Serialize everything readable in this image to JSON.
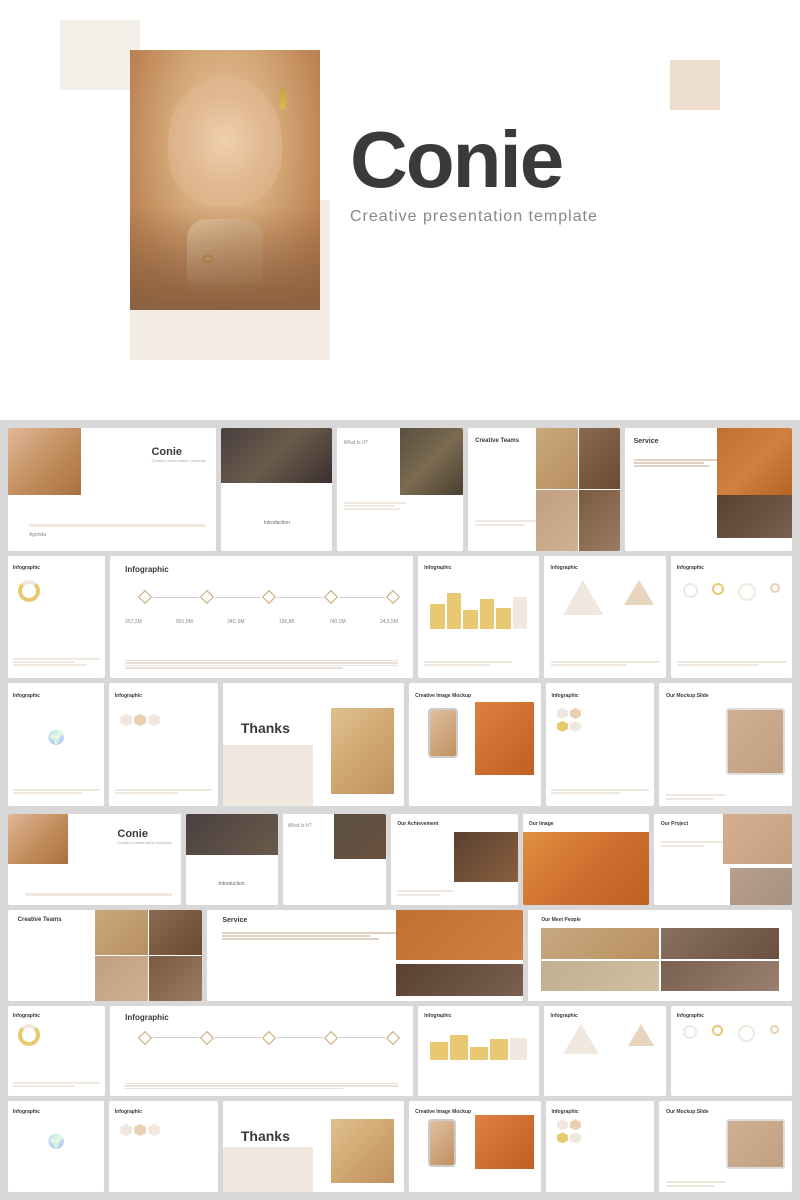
{
  "hero": {
    "title": "Conie",
    "subtitle": "Creative presentation template",
    "bg_color": "#ffffff",
    "accent_color": "#f0e8df",
    "text_color": "#3a3a3a"
  },
  "slides": {
    "row1": [
      {
        "id": "conie-main",
        "type": "title",
        "title": "Conie",
        "subtitle": "Creative presentation template"
      },
      {
        "id": "intro",
        "type": "section",
        "label": "Introduction"
      },
      {
        "id": "what-is-it",
        "type": "content",
        "label": "What Is It?"
      },
      {
        "id": "creative-teams",
        "type": "content",
        "label": "Creative Teams"
      },
      {
        "id": "service",
        "type": "content",
        "label": "Service"
      }
    ],
    "row2": [
      {
        "id": "infographic-1",
        "type": "infographic",
        "label": "Infographic"
      },
      {
        "id": "infographic-main",
        "type": "infographic",
        "label": "Infographic"
      },
      {
        "id": "infographic-3",
        "type": "infographic",
        "label": "Infographic"
      },
      {
        "id": "infographic-4",
        "type": "infographic",
        "label": "Infographic"
      },
      {
        "id": "infographic-5",
        "type": "infographic",
        "label": "Infographic"
      }
    ],
    "row3": [
      {
        "id": "infographic-6",
        "type": "infographic",
        "label": "Infographic"
      },
      {
        "id": "infographic-7",
        "type": "infographic",
        "label": "Infographic"
      },
      {
        "id": "thanks-1",
        "type": "thanks",
        "label": "Thanks"
      },
      {
        "id": "creative-image",
        "type": "content",
        "label": "Creative Image Mockup"
      },
      {
        "id": "infographic-8",
        "type": "infographic",
        "label": "Infographic"
      },
      {
        "id": "our-mockup",
        "type": "content",
        "label": "Our Mockup Slide"
      }
    ],
    "row4": [
      {
        "id": "conie-2",
        "type": "title",
        "title": "Conie",
        "subtitle": "Creative presentation template"
      },
      {
        "id": "intro-2",
        "type": "section",
        "label": "Introduction"
      },
      {
        "id": "what-2",
        "type": "content",
        "label": "What Is It?"
      },
      {
        "id": "achievement",
        "type": "content",
        "label": "Our Achievement"
      },
      {
        "id": "our-image",
        "type": "content",
        "label": "Our Image"
      },
      {
        "id": "our-project",
        "type": "content",
        "label": "Our Project"
      }
    ],
    "row5": [
      {
        "id": "creative-2",
        "type": "content",
        "label": "Creative Teams"
      },
      {
        "id": "service-2",
        "type": "content",
        "label": "Service"
      },
      {
        "id": "meet-people",
        "type": "content",
        "label": "Our Meet People"
      }
    ],
    "row6": [
      {
        "id": "infographic-9",
        "type": "infographic",
        "label": "Infographic"
      },
      {
        "id": "infographic-10",
        "type": "infographic",
        "label": "Infographic"
      },
      {
        "id": "infographic-11",
        "type": "infographic",
        "label": "Infographic"
      },
      {
        "id": "infographic-12",
        "type": "infographic",
        "label": "Infographic"
      },
      {
        "id": "infographic-13",
        "type": "infographic",
        "label": "Infographic"
      }
    ],
    "row7": [
      {
        "id": "infographic-14",
        "type": "infographic",
        "label": "Infographic"
      },
      {
        "id": "infographic-15",
        "type": "infographic",
        "label": "Infographic"
      },
      {
        "id": "thanks-2",
        "type": "thanks",
        "label": "Thanks"
      },
      {
        "id": "creative-image-2",
        "type": "content",
        "label": "Creative Image Mockup"
      },
      {
        "id": "infographic-16",
        "type": "infographic",
        "label": "Infographic"
      },
      {
        "id": "our-mockup-2",
        "type": "content",
        "label": "Our Mockup Slide"
      }
    ]
  },
  "thanks_text": "Thanks"
}
